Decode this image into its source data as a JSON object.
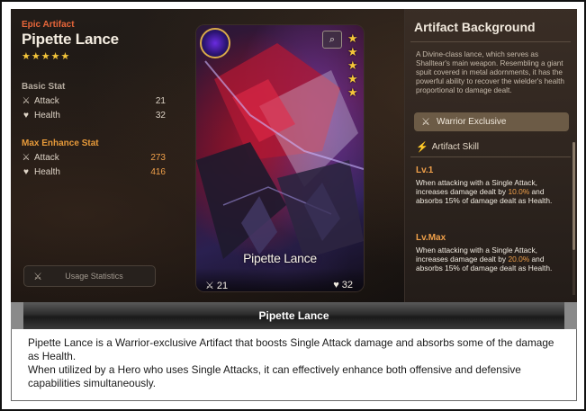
{
  "left": {
    "rarity": "Epic Artifact",
    "name": "Pipette Lance",
    "stars": 5,
    "basic_stat_title": "Basic Stat",
    "basic_stats": [
      {
        "label": "Attack",
        "value": "21",
        "icon": "sword-icon"
      },
      {
        "label": "Health",
        "value": "32",
        "icon": "heart-icon"
      }
    ],
    "max_stat_title": "Max Enhance Stat",
    "max_stats": [
      {
        "label": "Attack",
        "value": "273",
        "icon": "sword-icon"
      },
      {
        "label": "Health",
        "value": "416",
        "icon": "heart-icon"
      }
    ],
    "usage_button": "Usage Statistics"
  },
  "card": {
    "name": "Pipette Lance",
    "attack": "21",
    "health": "32",
    "stars": 5
  },
  "right": {
    "title": "Artifact Background",
    "background_text": "A Divine-class lance, which serves as Shalltear's main weapon. Resembling a giant spuit covered in metal adornments, it has the powerful ability to recover the wielder's health proportional to damage dealt.",
    "exclusive_label": "Warrior Exclusive",
    "skill_title": "Artifact Skill",
    "lv1_label": "Lv.1",
    "lv1": {
      "pre": "When attacking with a Single Attack, increases damage dealt by ",
      "hl": "10.0%",
      "post": " and absorbs 15% of damage dealt as Health."
    },
    "lvmax_label": "Lv.Max",
    "lvmax": {
      "pre": "When attacking with a Single Attack, increases damage dealt by ",
      "hl": "20.0%",
      "post": " and absorbs 15% of damage dealt as Health."
    }
  },
  "caption": "Pipette Lance",
  "description": [
    "Pipette Lance is a Warrior-exclusive Artifact that boosts Single Attack damage and absorbs some of the damage as Health.",
    "When utilized by a Hero who uses Single Attacks, it can effectively enhance both offensive and defensive capabilities simultaneously."
  ],
  "colors": {
    "accent_orange": "#f0a04a",
    "rarity_red": "#e8663a",
    "star_gold": "#f4c53a"
  }
}
